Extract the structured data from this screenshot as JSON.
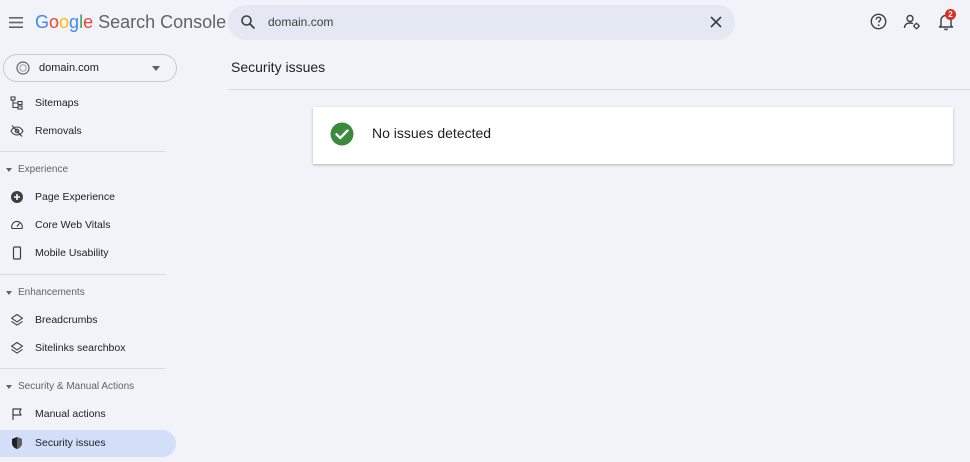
{
  "header": {
    "logo_google": "Google",
    "logo_product": "Search Console",
    "search_value": "domain.com",
    "notification_count": "2",
    "colors": {
      "google_blue": "#4285f4",
      "google_red": "#ea4335",
      "google_yellow": "#fbbc05",
      "google_green": "#34a853",
      "badge_red": "#d93025"
    }
  },
  "property": {
    "label": "domain.com"
  },
  "sidebar": {
    "top_items": [
      {
        "label": "Sitemaps",
        "icon": "sitemap-icon"
      },
      {
        "label": "Removals",
        "icon": "eye-off-icon"
      }
    ],
    "experience": {
      "title": "Experience",
      "items": [
        {
          "label": "Page Experience",
          "icon": "plus-circle-icon"
        },
        {
          "label": "Core Web Vitals",
          "icon": "speed-gauge-icon"
        },
        {
          "label": "Mobile Usability",
          "icon": "phone-icon"
        }
      ]
    },
    "enhancements": {
      "title": "Enhancements",
      "items": [
        {
          "label": "Breadcrumbs",
          "icon": "layers-icon"
        },
        {
          "label": "Sitelinks searchbox",
          "icon": "layers-icon"
        }
      ]
    },
    "security": {
      "title": "Security & Manual Actions",
      "items": [
        {
          "label": "Manual actions",
          "icon": "flag-icon"
        },
        {
          "label": "Security issues",
          "icon": "shield-icon",
          "active": true
        }
      ]
    }
  },
  "main": {
    "title": "Security issues",
    "status_message": "No issues detected",
    "status_color": "#3c8a3e"
  }
}
